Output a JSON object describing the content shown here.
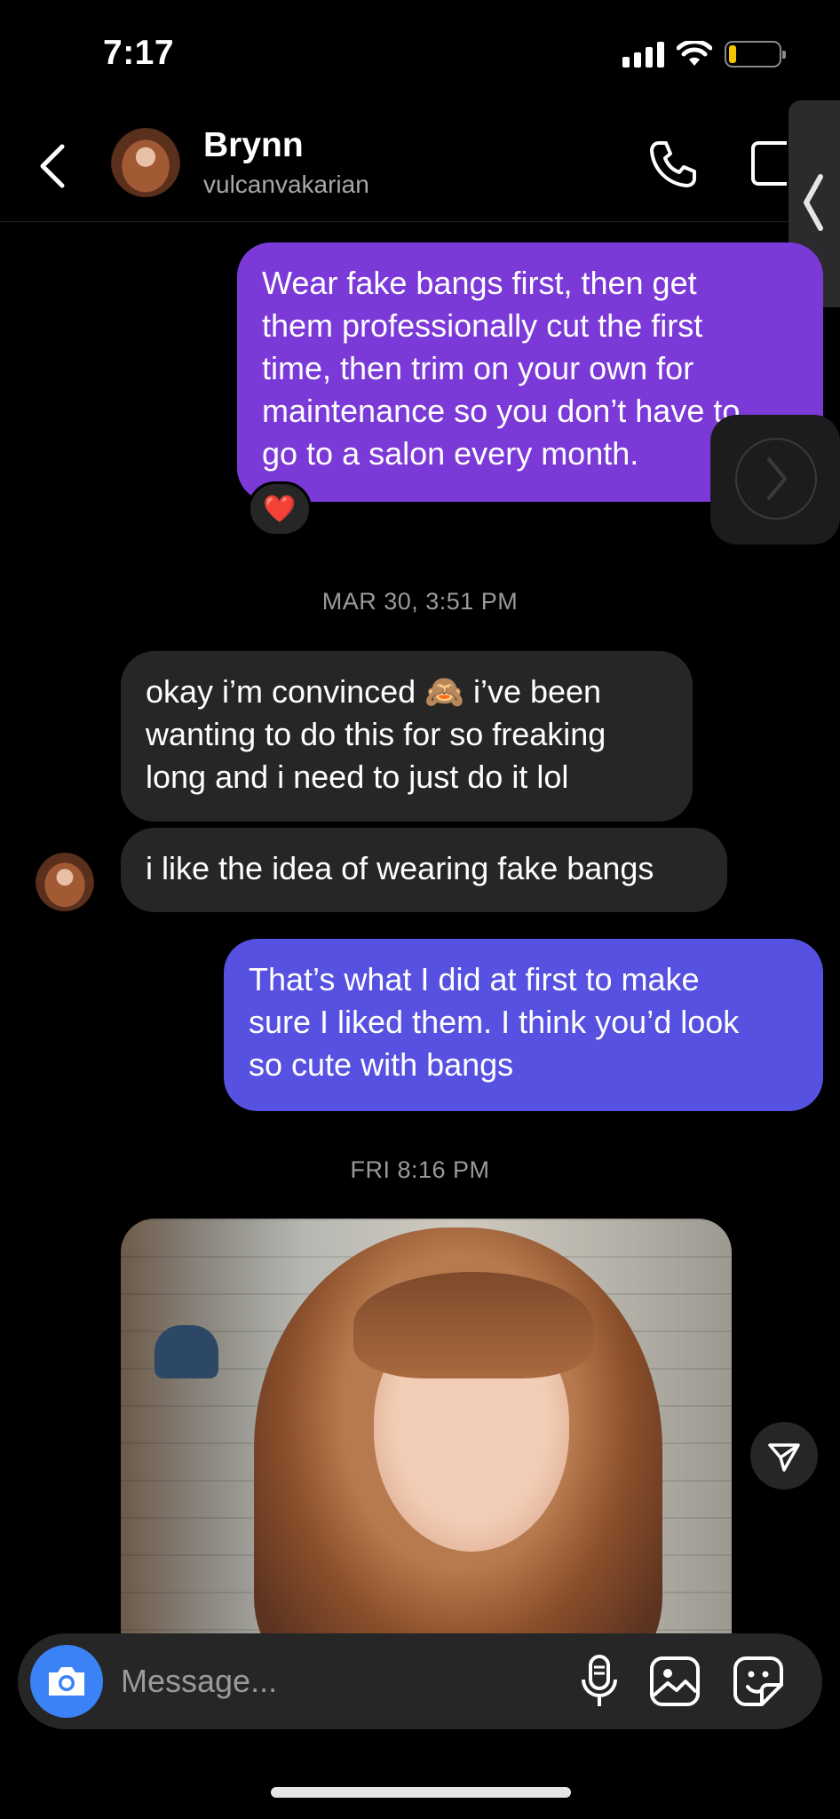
{
  "status_bar": {
    "time": "7:17"
  },
  "header": {
    "name": "Brynn",
    "handle": "vulcanvakarian",
    "icons": [
      "back-icon",
      "phone-icon",
      "video-icon"
    ]
  },
  "messages": [
    {
      "from": "me",
      "text": "Wear fake bangs first, then get\nthem professionally cut the first\ntime, then trim on your own for\nmaintenance so you don’t have to\ngo to a salon every month.",
      "reaction": "❤️"
    },
    {
      "type": "timestamp",
      "text": "MAR 30, 3:51 PM"
    },
    {
      "from": "them",
      "text": "okay i’m convinced 🙈 i’ve been\nwanting to do this for so freaking\nlong and i need to just do it lol"
    },
    {
      "from": "them",
      "text": "i like the idea of wearing fake bangs"
    },
    {
      "from": "me",
      "text": "That’s what I did at first to make\nsure I liked them. I think you’d look\nso cute with bangs"
    },
    {
      "type": "timestamp",
      "text": "FRI 8:16 PM"
    },
    {
      "from": "them",
      "type": "photo"
    }
  ],
  "composer": {
    "placeholder": "Message...",
    "icons": [
      "camera-icon",
      "microphone-icon",
      "gallery-icon",
      "sticker-icon"
    ]
  },
  "colors": {
    "outgoing_purple": "#7b3ad8",
    "outgoing_indigo": "#5651e0",
    "incoming": "#262626",
    "camera_blue": "#3b82f6",
    "battery": "#f5c400"
  }
}
